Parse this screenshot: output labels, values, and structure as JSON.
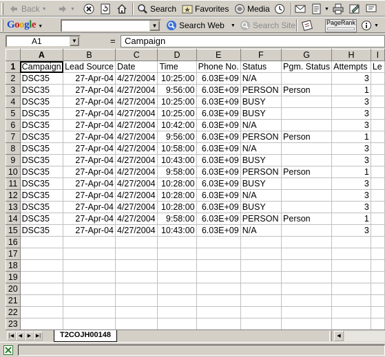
{
  "toolbar": {
    "back_label": "Back",
    "search_label": "Search",
    "favorites_label": "Favorites",
    "media_label": "Media"
  },
  "google_bar": {
    "logo_text": "Google",
    "search_value": "",
    "search_web_label": "Search Web",
    "search_site_label": "Search Site",
    "pagerank_label": "PageRank"
  },
  "formula_bar": {
    "name_box": "A1",
    "equals": "=",
    "formula": "Campaign"
  },
  "sheet": {
    "columns": [
      "A",
      "B",
      "C",
      "D",
      "E",
      "F",
      "G",
      "H",
      "I"
    ],
    "selected_column": "A",
    "selected_row": "1",
    "headers": [
      "Campaign",
      "Lead Source",
      "Date",
      "Time",
      "Phone No.",
      "Status",
      "Pgm. Status",
      "Attempts",
      "Le"
    ],
    "rows": [
      [
        "DSC35",
        "27-Apr-04",
        "4/27/2004",
        "10:25:00",
        "6.03E+09",
        "N/A",
        "",
        "3"
      ],
      [
        "DSC35",
        "27-Apr-04",
        "4/27/2004",
        "9:56:00",
        "6.03E+09",
        "PERSON",
        "Person",
        "1"
      ],
      [
        "DSC35",
        "27-Apr-04",
        "4/27/2004",
        "10:25:00",
        "6.03E+09",
        "BUSY",
        "",
        "3"
      ],
      [
        "DSC35",
        "27-Apr-04",
        "4/27/2004",
        "10:25:00",
        "6.03E+09",
        "BUSY",
        "",
        "3"
      ],
      [
        "DSC35",
        "27-Apr-04",
        "4/27/2004",
        "10:42:00",
        "6.03E+09",
        "N/A",
        "",
        "3"
      ],
      [
        "DSC35",
        "27-Apr-04",
        "4/27/2004",
        "9:56:00",
        "6.03E+09",
        "PERSON",
        "Person",
        "1"
      ],
      [
        "DSC35",
        "27-Apr-04",
        "4/27/2004",
        "10:58:00",
        "6.03E+09",
        "N/A",
        "",
        "3"
      ],
      [
        "DSC35",
        "27-Apr-04",
        "4/27/2004",
        "10:43:00",
        "6.03E+09",
        "BUSY",
        "",
        "3"
      ],
      [
        "DSC35",
        "27-Apr-04",
        "4/27/2004",
        "9:58:00",
        "6.03E+09",
        "PERSON",
        "Person",
        "1"
      ],
      [
        "DSC35",
        "27-Apr-04",
        "4/27/2004",
        "10:28:00",
        "6.03E+09",
        "BUSY",
        "",
        "3"
      ],
      [
        "DSC35",
        "27-Apr-04",
        "4/27/2004",
        "10:28:00",
        "6.03E+09",
        "N/A",
        "",
        "3"
      ],
      [
        "DSC35",
        "27-Apr-04",
        "4/27/2004",
        "10:28:00",
        "6.03E+09",
        "BUSY",
        "",
        "3"
      ],
      [
        "DSC35",
        "27-Apr-04",
        "4/27/2004",
        "9:58:00",
        "6.03E+09",
        "PERSON",
        "Person",
        "1"
      ],
      [
        "DSC35",
        "27-Apr-04",
        "4/27/2004",
        "10:43:00",
        "6.03E+09",
        "N/A",
        "",
        "3"
      ]
    ],
    "empty_rows": [
      16,
      17,
      18,
      19,
      20,
      21,
      22,
      23
    ]
  },
  "tabs": {
    "active_sheet": "T2COJH00148"
  },
  "colors": {
    "chrome": "#d4d0c8",
    "grid_line": "#c0c0c0",
    "header_shadow": "#808080"
  },
  "icons": [
    "back-arrow-icon",
    "forward-arrow-icon",
    "stop-icon",
    "refresh-icon",
    "home-icon",
    "search-icon",
    "favorites-icon",
    "media-icon",
    "history-icon",
    "mail-icon",
    "print-icon",
    "edit-icon",
    "discuss-icon",
    "google-search-icon",
    "search-site-icon",
    "info-icon",
    "excel-icon"
  ]
}
